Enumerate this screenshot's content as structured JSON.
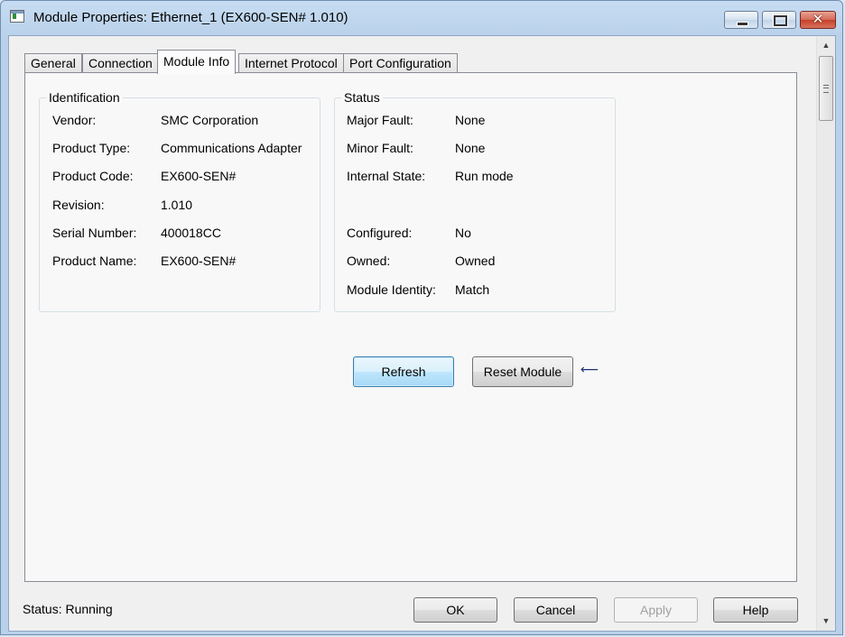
{
  "window": {
    "title": "Module Properties: Ethernet_1 (EX600-SEN# 1.010)",
    "minimize_glyph": "",
    "maximize_glyph": "",
    "close_glyph": "✕"
  },
  "tabs": [
    {
      "label": "General",
      "active": false
    },
    {
      "label": "Connection",
      "active": false
    },
    {
      "label": "Module Info",
      "active": true
    },
    {
      "label": "Internet Protocol",
      "active": false
    },
    {
      "label": "Port Configuration",
      "active": false
    }
  ],
  "identification": {
    "title": "Identification",
    "rows": [
      {
        "label": "Vendor:",
        "value": "SMC Corporation"
      },
      {
        "label": "Product Type:",
        "value": "Communications Adapter"
      },
      {
        "label": "Product Code:",
        "value": "EX600-SEN#"
      },
      {
        "label": "Revision:",
        "value": "1.010"
      },
      {
        "label": "Serial Number:",
        "value": "400018CC"
      },
      {
        "label": "Product Name:",
        "value": "EX600-SEN#"
      }
    ]
  },
  "status_group": {
    "title": "Status",
    "rows": [
      {
        "label": "Major Fault:",
        "value": "None"
      },
      {
        "label": "Minor Fault:",
        "value": "None"
      },
      {
        "label": "Internal State:",
        "value": "Run mode"
      },
      {
        "label": "Configured:",
        "value": "No"
      },
      {
        "label": "Owned:",
        "value": "Owned"
      },
      {
        "label": "Module Identity:",
        "value": "Match"
      }
    ]
  },
  "actions": {
    "refresh": "Refresh",
    "reset_module": "Reset Module",
    "arrow": "⟵"
  },
  "footer": {
    "status_label": "Status:",
    "status_value": "Running",
    "ok": "OK",
    "cancel": "Cancel",
    "apply": "Apply",
    "help": "Help"
  },
  "scrollbar": {
    "up": "▲",
    "down": "▼"
  },
  "icons": {
    "app": "module-properties-icon",
    "arrow": "left-arrow-icon"
  }
}
